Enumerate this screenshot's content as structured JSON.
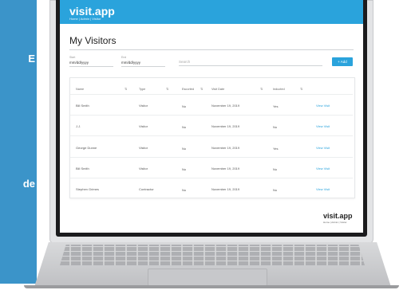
{
  "left_panel": {
    "fragments": [
      "E",
      "de"
    ]
  },
  "app": {
    "logo": "visit.app",
    "logo_sub": "Home | Admin | Visitor",
    "page_title": "My Visitors",
    "filters": {
      "from_label": "Start",
      "from_value": "mm/dd/yyyy",
      "to_label": "End",
      "to_value": "mm/dd/yyyy",
      "search_placeholder": "Search",
      "add_button": "+ Add"
    },
    "table": {
      "columns": [
        "Name",
        "Type",
        "Escorted",
        "Visit Date",
        "Inducted",
        ""
      ],
      "rows": [
        [
          "Bill Smith",
          "Visitor",
          "No",
          "November 19, 2019",
          "Yes",
          "View Visit"
        ],
        [
          "J.J.",
          "Visitor",
          "No",
          "November 19, 2019",
          "No",
          "View Visit"
        ],
        [
          "George Dunne",
          "Visitor",
          "No",
          "November 19, 2019",
          "Yes",
          "View Visit"
        ],
        [
          "Bill Smith",
          "Visitor",
          "No",
          "November 19, 2019",
          "No",
          "View Visit"
        ],
        [
          "Stephen Grimes",
          "Contractor",
          "No",
          "November 19, 2019",
          "No",
          "View Visit"
        ]
      ]
    },
    "footer_brand": "visit.app",
    "footer_brand_sub": "Home | Admin | Visitor"
  },
  "colors": {
    "panel_blue": "#3b94c9",
    "header_blue": "#2aa3dc"
  }
}
